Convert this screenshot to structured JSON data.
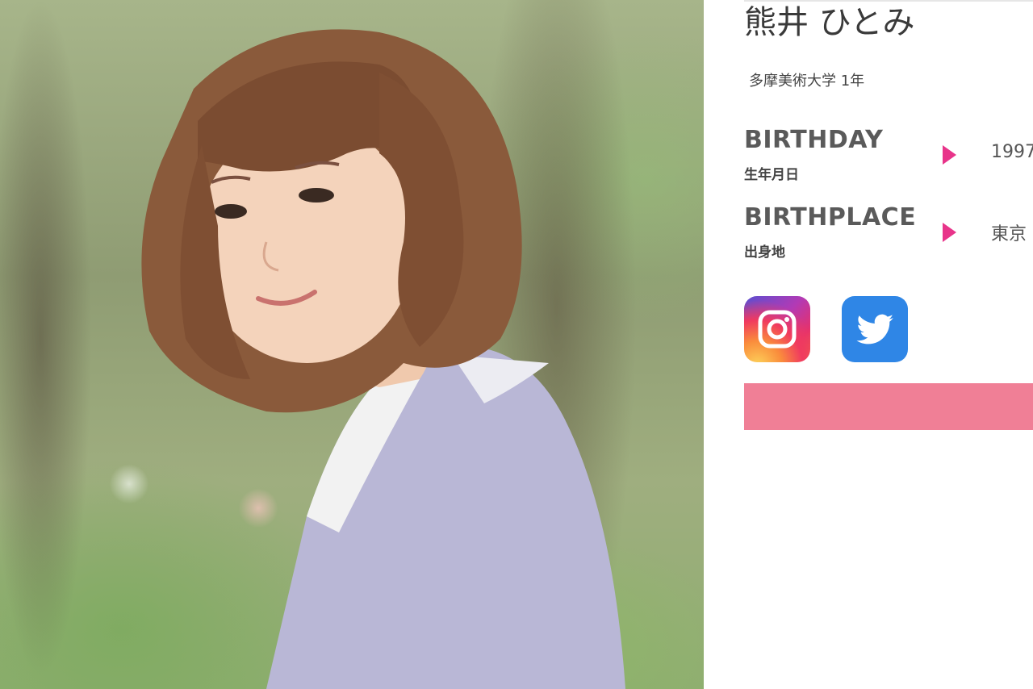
{
  "profile": {
    "name": "熊井 ひとみ",
    "school": "多摩美術大学 1年",
    "fields": [
      {
        "label_en": "BIRTHDAY",
        "label_ja": "生年月日",
        "value": "1997"
      },
      {
        "label_en": "BIRTHPLACE",
        "label_ja": "出身地",
        "value": "東京"
      }
    ]
  },
  "social": [
    {
      "icon": "instagram-icon",
      "color": "#e1306c"
    },
    {
      "icon": "twitter-icon",
      "color": "#2f86e6"
    }
  ],
  "colors": {
    "accent_arrow": "#e8348a",
    "bar": "#f07f96"
  }
}
